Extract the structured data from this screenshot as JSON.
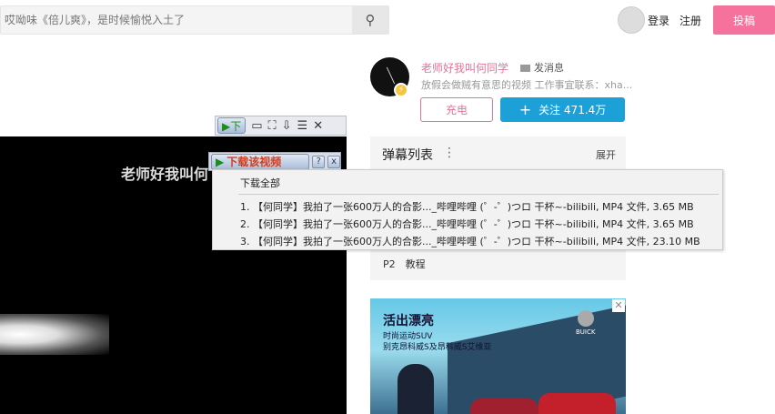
{
  "header": {
    "search_placeholder": "哎呦味《倍儿爽》，是时候愉悦入土了",
    "search_icon": "search-icon",
    "login": "登录",
    "register": "注册",
    "upload": "投稿"
  },
  "uploader": {
    "name": "老师好我叫何同学",
    "message": "发消息",
    "description": "放假会做贼有意思的视频 工作事宜联系：xha...",
    "charge": "充电",
    "follow": "关注 471.4万",
    "follow_icon": "+",
    "badge_icon": "⚡"
  },
  "danmaku": {
    "title": "弹幕列表",
    "more": "⋮",
    "expand": "展开"
  },
  "playlist": {
    "item": "P2　教程"
  },
  "ad": {
    "title": "活出漂亮",
    "sub1": "时尚运动SUV",
    "sub2": "别克昂科威S及昂科威S艾维亚",
    "brand": "BUICK",
    "close": "✕"
  },
  "video": {
    "title": "老师好我叫何"
  },
  "downloader": {
    "toolbar_play": "▶下",
    "toolbar_icons": [
      "▭",
      "⛶",
      "⇩",
      "☰",
      "✕"
    ],
    "button_label": "下载该视频",
    "help": "?",
    "close": "x",
    "download_all": "下载全部",
    "items": [
      "1.  【何同学】我拍了一张600万人的合影..._哔哩哔哩 (゜-゜)つロ 干杯~-bilibili,  MP4 文件, 3.65 MB",
      "2.  【何同学】我拍了一张600万人的合影..._哔哩哔哩 (゜-゜)つロ 干杯~-bilibili,  MP4 文件, 3.65 MB",
      "3.  【何同学】我拍了一张600万人的合影..._哔哩哔哩 (゜-゜)つロ 干杯~-bilibili,  MP4 文件, 23.10 MB"
    ]
  }
}
